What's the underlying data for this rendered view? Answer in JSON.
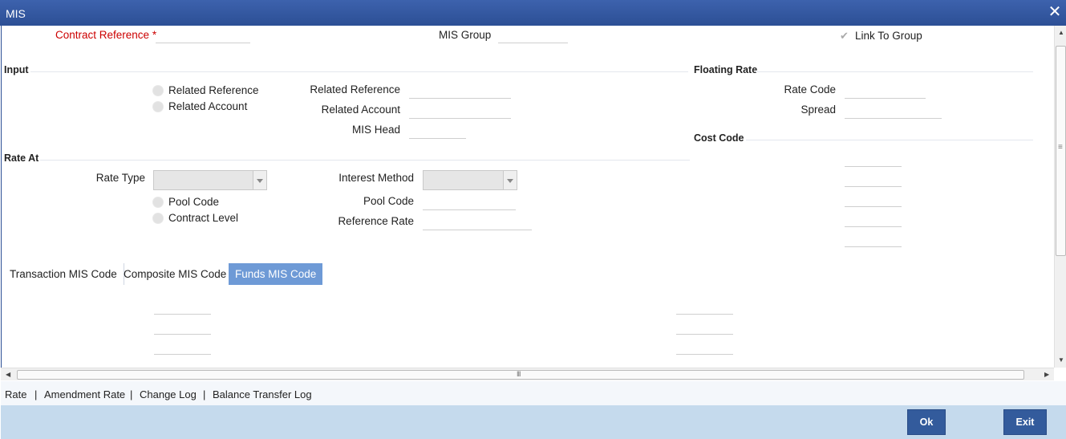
{
  "window": {
    "title": "MIS",
    "close_glyph": "✕"
  },
  "header": {
    "contract_reference_label": "Contract Reference",
    "required_marker": "*",
    "mis_group_label": "MIS Group",
    "link_to_group_label": "Link To Group",
    "link_to_group_checked": true
  },
  "input_section": {
    "title": "Input",
    "radio_related_reference": "Related Reference",
    "radio_related_account": "Related Account",
    "related_reference_label": "Related Reference",
    "related_account_label": "Related Account",
    "mis_head_label": "MIS Head"
  },
  "floating_rate_section": {
    "title": "Floating Rate",
    "rate_code_label": "Rate Code",
    "spread_label": "Spread"
  },
  "cost_code_section": {
    "title": "Cost Code"
  },
  "rate_at_section": {
    "title": "Rate At",
    "rate_type_label": "Rate Type",
    "radio_pool_code": "Pool Code",
    "radio_contract_level": "Contract Level",
    "interest_method_label": "Interest Method",
    "pool_code_label": "Pool Code",
    "reference_rate_label": "Reference Rate"
  },
  "tabs": [
    {
      "label": "Transaction MIS Code",
      "active": false
    },
    {
      "label": "Composite MIS Code",
      "active": false
    },
    {
      "label": "Funds MIS Code",
      "active": true
    }
  ],
  "bottom_links": [
    "Rate",
    "Amendment Rate",
    "Change Log",
    "Balance Transfer Log"
  ],
  "link_separator": "|",
  "buttons": {
    "ok": "Ok",
    "exit": "Exit"
  },
  "colors": {
    "titlebar": "#2c4f95",
    "required": "#cc0000",
    "active_tab": "#6e9ad6",
    "footer": "#c5daed",
    "button": "#335b9c"
  }
}
